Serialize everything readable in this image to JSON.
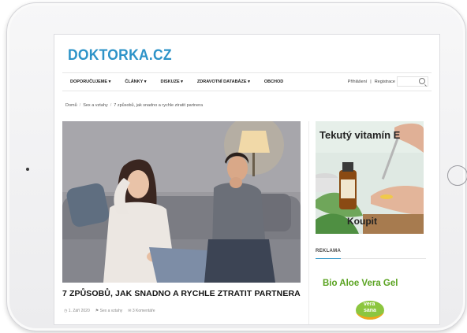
{
  "site": {
    "logo_main": "DOKTORKA",
    "logo_tld": ".CZ"
  },
  "nav": {
    "items": [
      {
        "label": "DOPORUČUJEME ▾"
      },
      {
        "label": "ČLÁNKY ▾"
      },
      {
        "label": "DISKUZE ▾"
      },
      {
        "label": "ZDRAVOTNÍ DATABÁZE ▾"
      },
      {
        "label": "OBCHOD"
      }
    ],
    "login": "Přihlášení",
    "separator": "|",
    "register": "Registrace",
    "search_placeholder": ""
  },
  "breadcrumb": {
    "home": "Domů",
    "category": "Sex a vztahy",
    "current": "7 způsobů, jak snadno a rychle ztratit partnera",
    "sep": "/"
  },
  "article": {
    "title": "7 ZPŮSOBŮ, JAK SNADNO A RYCHLE ZTRATIT PARTNERA",
    "date": "1. Září 2020",
    "category": "Sex a vztahy",
    "comments": "3 Komentáře"
  },
  "sidebar": {
    "ad_headline": "Tekutý vitamín E",
    "ad_cta": "Koupit",
    "reklama_label": "REKLAMA",
    "aloe_title": "Bio Aloe Vera Gel",
    "brand_top": "vera",
    "brand_bottom": "sana"
  },
  "colors": {
    "brand": "#2d93c8",
    "aloe_green": "#5aa321",
    "text": "#111111"
  }
}
